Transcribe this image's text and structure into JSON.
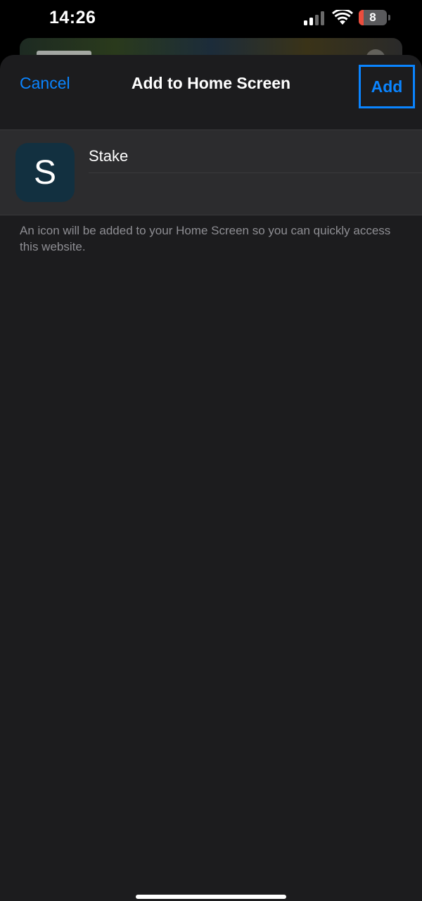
{
  "status_bar": {
    "time": "14:26",
    "battery_level": "8",
    "signal_icon": "cellular-signal-icon",
    "wifi_icon": "wifi-icon",
    "battery_icon": "battery-icon"
  },
  "nav": {
    "cancel_label": "Cancel",
    "title": "Add to Home Screen",
    "add_label": "Add"
  },
  "shortcut": {
    "icon_letter": "S",
    "name_value": "Stake",
    "url": ""
  },
  "footnote": "An icon will be added to your Home Screen so you can quickly access this website.",
  "colors": {
    "accent": "#0a84ff",
    "sheet_background": "#1c1c1e",
    "row_background": "#2c2c2e",
    "secondary_text": "#8e8e93",
    "icon_background": "#123040"
  }
}
